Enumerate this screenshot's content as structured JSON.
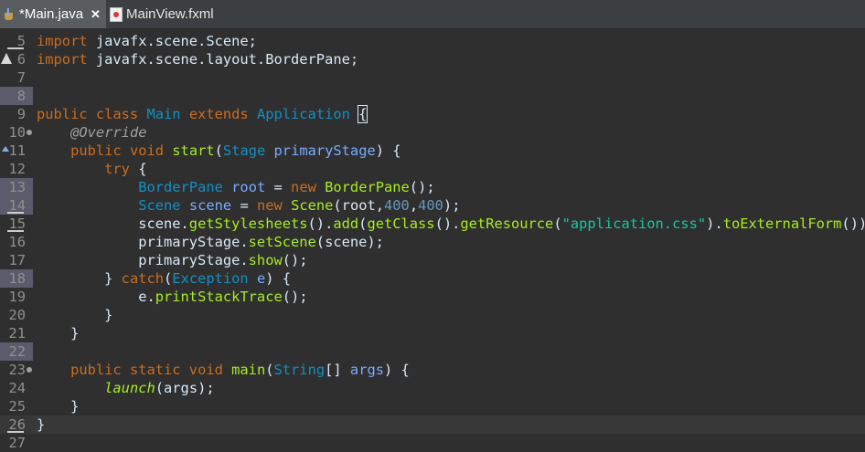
{
  "tabs": [
    {
      "label": "*Main.java",
      "close": "✕",
      "active": true,
      "icon": "java-file-icon"
    },
    {
      "label": "MainView.fxml",
      "active": false,
      "icon": "fxml-file-icon"
    }
  ],
  "colors": {
    "background": "#2f2f2f",
    "keyword": "#cc6c1d",
    "type": "#1290c3",
    "method": "#a7ec21",
    "variable": "#79abff",
    "string": "#17c6a3",
    "number": "#6897bb",
    "text": "#d9e8f7"
  },
  "editor": {
    "lines": [
      {
        "n": "5",
        "tokens": [
          [
            "kw",
            "import"
          ],
          [
            "plain",
            " javafx.scene.Scene;"
          ]
        ]
      },
      {
        "n": "6",
        "tokens": [
          [
            "kw",
            "import"
          ],
          [
            "plain",
            " javafx.scene.layout.BorderPane;"
          ]
        ]
      },
      {
        "n": "7",
        "tokens": []
      },
      {
        "n": "8",
        "tokens": []
      },
      {
        "n": "9",
        "tokens": [
          [
            "kw",
            "public class "
          ],
          [
            "ty",
            "Main"
          ],
          [
            "kw",
            " extends "
          ],
          [
            "ty",
            "Application"
          ],
          [
            "plain",
            " "
          ],
          [
            "bracket",
            "{"
          ]
        ]
      },
      {
        "n": "10",
        "tokens": [
          [
            "plain",
            "    "
          ],
          [
            "ann",
            "@Override"
          ]
        ]
      },
      {
        "n": "11",
        "tokens": [
          [
            "plain",
            "    "
          ],
          [
            "kw",
            "public void "
          ],
          [
            "fn",
            "start"
          ],
          [
            "plain",
            "("
          ],
          [
            "ty",
            "Stage"
          ],
          [
            "plain",
            " "
          ],
          [
            "var",
            "primaryStage"
          ],
          [
            "plain",
            ") {"
          ]
        ]
      },
      {
        "n": "12",
        "tokens": [
          [
            "plain",
            "        "
          ],
          [
            "kw",
            "try"
          ],
          [
            "plain",
            " {"
          ]
        ]
      },
      {
        "n": "13",
        "tokens": [
          [
            "plain",
            "            "
          ],
          [
            "ty",
            "BorderPane"
          ],
          [
            "plain",
            " "
          ],
          [
            "var",
            "root"
          ],
          [
            "plain",
            " = "
          ],
          [
            "kw",
            "new "
          ],
          [
            "fn",
            "BorderPane"
          ],
          [
            "plain",
            "();"
          ]
        ]
      },
      {
        "n": "14",
        "tokens": [
          [
            "plain",
            "            "
          ],
          [
            "ty",
            "Scene"
          ],
          [
            "plain",
            " "
          ],
          [
            "var",
            "scene"
          ],
          [
            "plain",
            " = "
          ],
          [
            "kw",
            "new "
          ],
          [
            "fn",
            "Scene"
          ],
          [
            "plain",
            "(root,"
          ],
          [
            "num",
            "400"
          ],
          [
            "plain",
            ","
          ],
          [
            "num",
            "400"
          ],
          [
            "plain",
            ");"
          ]
        ]
      },
      {
        "n": "15",
        "tokens": [
          [
            "plain",
            "            scene."
          ],
          [
            "fn",
            "getStylesheets"
          ],
          [
            "plain",
            "()."
          ],
          [
            "fn",
            "add"
          ],
          [
            "plain",
            "("
          ],
          [
            "fn",
            "getClass"
          ],
          [
            "plain",
            "()."
          ],
          [
            "fn",
            "getResource"
          ],
          [
            "plain",
            "("
          ],
          [
            "str",
            "\"application.css\""
          ],
          [
            "plain",
            ")."
          ],
          [
            "fn",
            "toExternalForm"
          ],
          [
            "plain",
            "());"
          ]
        ]
      },
      {
        "n": "16",
        "tokens": [
          [
            "plain",
            "            primaryStage."
          ],
          [
            "fn",
            "setScene"
          ],
          [
            "plain",
            "(scene);"
          ]
        ]
      },
      {
        "n": "17",
        "tokens": [
          [
            "plain",
            "            primaryStage."
          ],
          [
            "fn",
            "show"
          ],
          [
            "plain",
            "();"
          ]
        ]
      },
      {
        "n": "18",
        "tokens": [
          [
            "plain",
            "        } "
          ],
          [
            "kw",
            "catch"
          ],
          [
            "plain",
            "("
          ],
          [
            "ty",
            "Exception"
          ],
          [
            "plain",
            " "
          ],
          [
            "var",
            "e"
          ],
          [
            "plain",
            ") {"
          ]
        ]
      },
      {
        "n": "19",
        "tokens": [
          [
            "plain",
            "            e."
          ],
          [
            "fn",
            "printStackTrace"
          ],
          [
            "plain",
            "();"
          ]
        ]
      },
      {
        "n": "20",
        "tokens": [
          [
            "plain",
            "        }"
          ]
        ]
      },
      {
        "n": "21",
        "tokens": [
          [
            "plain",
            "    }"
          ]
        ]
      },
      {
        "n": "22",
        "tokens": []
      },
      {
        "n": "23",
        "tokens": [
          [
            "plain",
            "    "
          ],
          [
            "kw",
            "public static void "
          ],
          [
            "fn",
            "main"
          ],
          [
            "plain",
            "("
          ],
          [
            "ty",
            "String"
          ],
          [
            "plain",
            "[] "
          ],
          [
            "var",
            "args"
          ],
          [
            "plain",
            ") {"
          ]
        ]
      },
      {
        "n": "24",
        "tokens": [
          [
            "plain",
            "        "
          ],
          [
            "it",
            "launch"
          ],
          [
            "plain",
            "(args);"
          ]
        ]
      },
      {
        "n": "25",
        "tokens": [
          [
            "plain",
            "    }"
          ]
        ]
      },
      {
        "n": "26",
        "tokens": [
          [
            "plain",
            "}"
          ]
        ]
      },
      {
        "n": "27",
        "tokens": []
      }
    ]
  }
}
